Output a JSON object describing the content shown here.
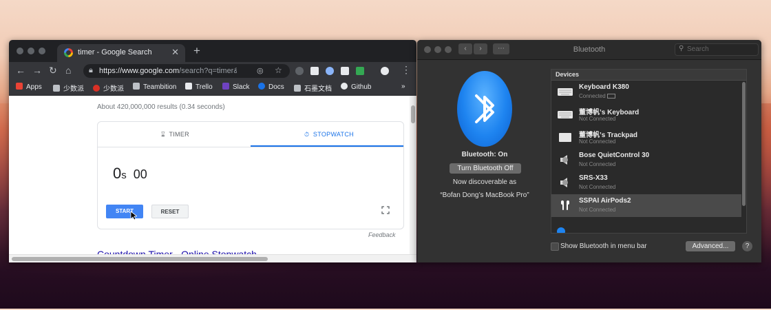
{
  "chrome": {
    "tab_title": "timer - Google Search",
    "tab_close": "✕",
    "new_tab": "+",
    "url_main": "https://www.google.com",
    "url_rest": "/search?q=timer&...",
    "bookmarks": [
      {
        "label": "Apps",
        "color": "#ea4335"
      },
      {
        "label": "少数派",
        "color": "#bdc1c6"
      },
      {
        "label": "少数派",
        "color": "#d93025"
      },
      {
        "label": "Teambition",
        "color": "#bdc1c6"
      },
      {
        "label": "Trello",
        "color": "#bdc1c6"
      },
      {
        "label": "Slack",
        "color": "#6f42c1"
      },
      {
        "label": "Docs",
        "color": "#1a73e8"
      },
      {
        "label": "石墨文档",
        "color": "#bdc1c6"
      },
      {
        "label": "Github",
        "color": "#bdc1c6"
      }
    ],
    "bookmarks_more": "»"
  },
  "search": {
    "results_stats": "About 420,000,000 results (0.34 seconds)",
    "tab_timer": "TIMER",
    "tab_stopwatch": "STOPWATCH",
    "seconds": "0",
    "seconds_unit": "s",
    "centiseconds": "00",
    "start_label": "START",
    "reset_label": "RESET",
    "feedback": "Feedback",
    "next_result": "Countdown Timer - Online Stopwatch"
  },
  "bluetooth": {
    "window_title": "Bluetooth",
    "search_placeholder": "Search",
    "status": "Bluetooth: On",
    "toggle_label": "Turn Bluetooth Off",
    "discoverable": "Now discoverable as",
    "computer_name": "“Bofan Dong’s MacBook Pro”",
    "devices_header": "Devices",
    "devices": [
      {
        "name": "Keyboard K380",
        "status": "Connected",
        "icon": "keyboard-icon"
      },
      {
        "name": "董博帆’s Keyboard",
        "status": "Not Connected",
        "icon": "keyboard-icon"
      },
      {
        "name": "董博帆’s Trackpad",
        "status": "Not Connected",
        "icon": "trackpad-icon"
      },
      {
        "name": "Bose QuietControl 30",
        "status": "Not Connected",
        "icon": "speaker-icon"
      },
      {
        "name": "SRS-X33",
        "status": "Not Connected",
        "icon": "speaker-icon"
      },
      {
        "name": "SSPAI AirPods2",
        "status": "Not Connected",
        "icon": "airpods-icon"
      }
    ],
    "show_in_menu_bar": "Show Bluetooth in menu bar",
    "advanced_label": "Advanced...",
    "help_label": "?"
  },
  "colors": {
    "google_blue": "#1a73e8",
    "start_button": "#4285f4",
    "bluetooth_blue": "#1e84f0"
  }
}
